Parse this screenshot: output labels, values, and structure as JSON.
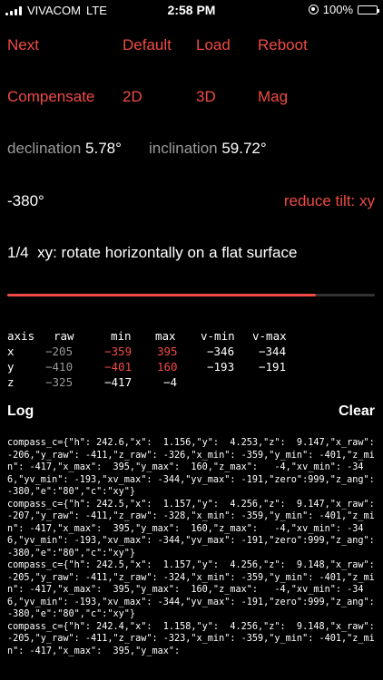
{
  "status": {
    "carrier": "VIVACOM",
    "network": "LTE",
    "time": "2:58 PM",
    "battery": "100%"
  },
  "buttons_row1": [
    "Next",
    "Default",
    "Load",
    "Reboot"
  ],
  "buttons_row2": [
    "Compensate",
    "2D",
    "3D",
    "Mag"
  ],
  "readouts": {
    "declination_label": "declination",
    "declination_value": "5.78°",
    "inclination_label": "inclination",
    "inclination_value": "59.72°"
  },
  "angle": "-380°",
  "reduce_tilt": "reduce tilt: xy",
  "step": {
    "index": "1/4",
    "instruction": "xy: rotate horizontally on a flat surface",
    "progress": 0.84
  },
  "axis_table": {
    "headers": [
      "axis",
      "raw",
      "min",
      "max",
      "v-min",
      "v-max"
    ],
    "rows": [
      {
        "axis": "x",
        "raw": "−205",
        "min": "−359",
        "max": "395",
        "vmin": "−346",
        "vmax": "−344"
      },
      {
        "axis": "y",
        "raw": "−410",
        "min": "−401",
        "max": "160",
        "vmin": "−193",
        "vmax": "−191"
      },
      {
        "axis": "z",
        "raw": "−325",
        "min": "−417",
        "max": "−4",
        "vmin": "",
        "vmax": ""
      }
    ]
  },
  "log": {
    "title": "Log",
    "clear_label": "Clear",
    "text": "compass_c={\"h\": 242.6,\"x\":  1.156,\"y\":  4.253,\"z\":  9.147,\"x_raw\": -206,\"y_raw\": -411,\"z_raw\": -326,\"x_min\": -359,\"y_min\": -401,\"z_min\": -417,\"x_max\":  395,\"y_max\":  160,\"z_max\":   -4,\"xv_min\": -346,\"yv_min\": -193,\"xv_max\": -344,\"yv_max\": -191,\"zero\":999,\"z_ang\":-380,\"e\":\"80\",\"c\":\"xy\"}\ncompass_c={\"h\": 242.5,\"x\":  1.157,\"y\":  4.256,\"z\":  9.147,\"x_raw\": -207,\"y_raw\": -411,\"z_raw\": -328,\"x_min\": -359,\"y_min\": -401,\"z_min\": -417,\"x_max\":  395,\"y_max\":  160,\"z_max\":   -4,\"xv_min\": -346,\"yv_min\": -193,\"xv_max\": -344,\"yv_max\": -191,\"zero\":999,\"z_ang\":-380,\"e\":\"80\",\"c\":\"xy\"}\ncompass_c={\"h\": 242.5,\"x\":  1.157,\"y\":  4.256,\"z\":  9.148,\"x_raw\": -205,\"y_raw\": -411,\"z_raw\": -324,\"x_min\": -359,\"y_min\": -401,\"z_min\": -417,\"x_max\":  395,\"y_max\":  160,\"z_max\":   -4,\"xv_min\": -346,\"yv_min\": -193,\"xv_max\": -344,\"yv_max\": -191,\"zero\":999,\"z_ang\":-380,\"e\":\"80\",\"c\":\"xy\"}\ncompass_c={\"h\": 242.4,\"x\":  1.158,\"y\":  4.256,\"z\":  9.148,\"x_raw\": -205,\"y_raw\": -411,\"z_raw\": -323,\"x_min\": -359,\"y_min\": -401,\"z_min\": -417,\"x_max\":  395,\"y_max\":"
  },
  "colors": {
    "accent": "#f04b45",
    "muted": "#9a9a9a",
    "background": "#000000"
  }
}
